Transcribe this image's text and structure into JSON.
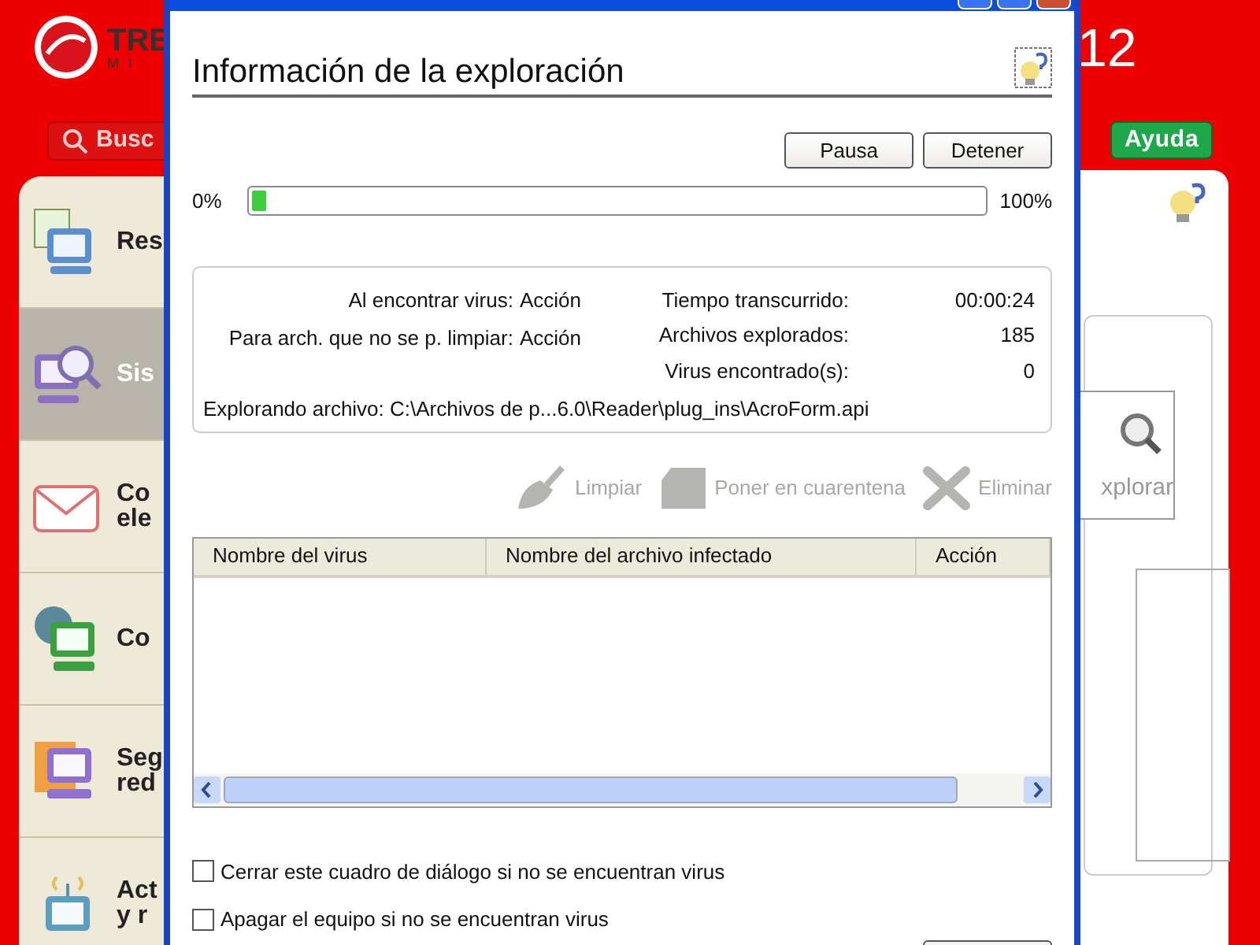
{
  "background_app": {
    "logo_text": "TRE",
    "logo_subtext": "MI",
    "version": "12",
    "search_button": "Busc",
    "help_button": "Ayuda",
    "sidebar": [
      {
        "kind": "report",
        "lines": [
          "Res"
        ],
        "selected": false
      },
      {
        "kind": "scan",
        "lines": [
          "Sis"
        ],
        "selected": true
      },
      {
        "kind": "mail",
        "lines": [
          "Co",
          "ele"
        ],
        "selected": false
      },
      {
        "kind": "network",
        "lines": [
          "Co"
        ],
        "selected": false
      },
      {
        "kind": "security",
        "lines": [
          "Seg",
          "red"
        ],
        "selected": false
      },
      {
        "kind": "update",
        "lines": [
          "Act",
          "y r"
        ],
        "selected": false
      }
    ],
    "scan_button": "xplorar"
  },
  "dialog": {
    "heading": "Información de la exploración",
    "buttons": [
      "Pausa",
      "Detener"
    ],
    "progress": {
      "start_label": "0%",
      "end_label": "100%",
      "level": 0.02
    },
    "info": {
      "left": [
        {
          "label": "Al encontrar virus:",
          "value": "Acción"
        },
        {
          "label": "Para arch. que no se p. limpiar:",
          "value": "Acción"
        }
      ],
      "right": [
        {
          "label": "Tiempo transcurrido:",
          "value": "00:00:24"
        },
        {
          "label": "Archivos explorados:",
          "value": "185"
        },
        {
          "label": "Virus encontrado(s):",
          "value": "0"
        }
      ],
      "current_file": "Explorando archivo: C:\\Archivos de p...6.0\\Reader\\plug_ins\\AcroForm.api"
    },
    "actions": [
      {
        "kind": "clean",
        "label": "Limpiar",
        "disabled": true
      },
      {
        "kind": "quarantine",
        "label": "Poner en cuarentena",
        "disabled": true
      },
      {
        "kind": "delete",
        "label": "Eliminar",
        "disabled": true
      }
    ],
    "table": {
      "columns": [
        "Nombre del virus",
        "Nombre del archivo infectado",
        "Acción"
      ]
    },
    "checkboxes": [
      {
        "label": "Cerrar este cuadro de diálogo si no se encuentran virus",
        "checked": false
      },
      {
        "label": "Apagar el equipo si no se encuentran virus",
        "checked": false
      }
    ]
  }
}
